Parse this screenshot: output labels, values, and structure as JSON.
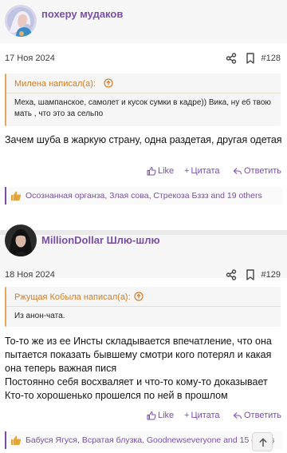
{
  "colors": {
    "accent": "#7a4ea7",
    "quote_accent": "#d27e2a",
    "like_icon": "#e5a53a"
  },
  "posts": [
    {
      "author": "похеру мудаков",
      "date": "17 Ноя 2024",
      "number": "#128",
      "quote": {
        "header": "Милена написал(а):",
        "text": "Меха, шампанское, самолет и кусок сумки в кадре)) Вика, ну еб твою мать , что это за сельпо"
      },
      "body": "Зачем шуба в жаркую страну, одна раздетая, другая одетая",
      "actions": {
        "like": "Like",
        "quote": "Цитата",
        "reply": "Ответить"
      },
      "reactions": "Осознанная органза, Злая сова, Стрекоза Бззз and 19 others"
    },
    {
      "author": "MillionDollar Шлю-шлю",
      "date": "18 Ноя 2024",
      "number": "#129",
      "quote": {
        "header": "Ржущая Кобыла написал(а):",
        "text": "Из анон-чата."
      },
      "body_lines": [
        "То-то же из ее Инсты складывается впечатление, что она",
        "пытается показать бывшему смотри кого потерял и какая",
        "она теперь важная пися",
        "Постоянно себя восхваляет и что-то кому-то доказывает",
        "Кто-то хорошенько прошелся по ней в прошлом"
      ],
      "actions": {
        "like": "Like",
        "quote": "Цитата",
        "reply": "Ответить"
      },
      "reactions": "Бабуся Ягуся, Всратая блузка, Goodnewseveryone and 15 others"
    }
  ]
}
